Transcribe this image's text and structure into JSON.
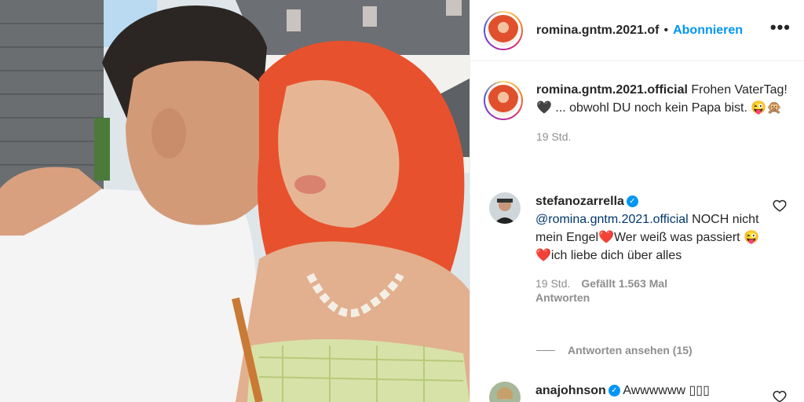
{
  "post": {
    "username": "romina.gntm.2021.of",
    "dot": "•",
    "follow_label": "Abonnieren",
    "more_icon": "•••"
  },
  "caption": {
    "username": "romina.gntm.2021.official",
    "text": "Frohen VaterTag! 🖤 ... obwohl DU noch kein Papa bist. 😜🙊",
    "time": "19 Std."
  },
  "comments": [
    {
      "username": "stefanozarrella",
      "mention": "@romina.gntm.2021.official",
      "text": " NOCH nicht mein Engel❤️Wer weiß was passiert 😜❤️ich liebe dich über alles",
      "time": "19 Std.",
      "likes": "Gefällt 1.563 Mal",
      "reply": "Antworten",
      "view_replies": "Antworten ansehen (15)"
    },
    {
      "username": "anajohnson",
      "text": "Awwwwww ▯▯▯"
    }
  ],
  "icons": {
    "verified": "✓"
  },
  "colors": {
    "link": "#0095f6",
    "text": "#262626",
    "muted": "#8e8e8e",
    "mention": "#00376b"
  }
}
